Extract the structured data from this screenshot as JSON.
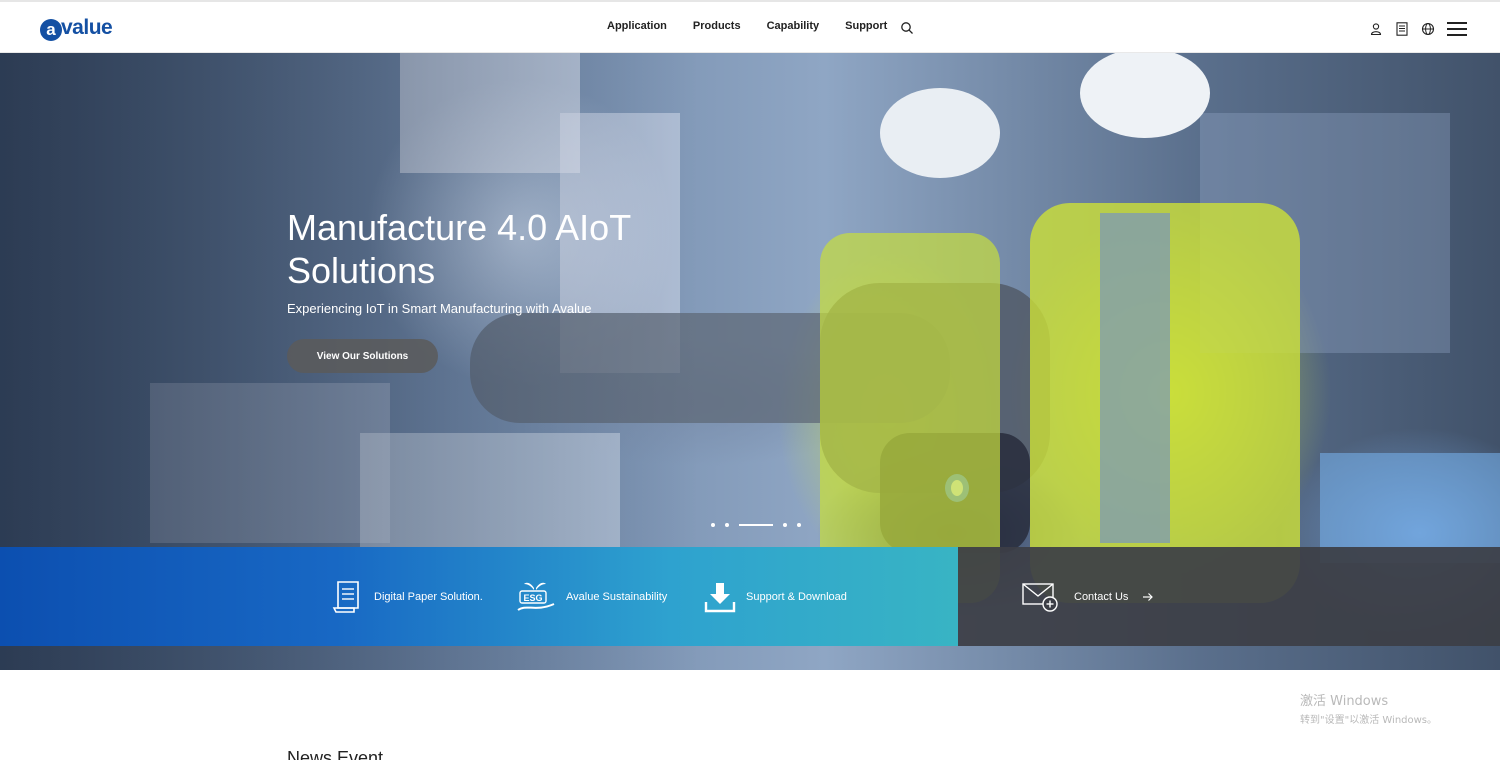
{
  "header": {
    "logo_letter": "a",
    "logo_text": "value",
    "nav": [
      "Application",
      "Products",
      "Capability",
      "Support"
    ],
    "icons": [
      "search-icon",
      "user-icon",
      "document-icon",
      "globe-icon",
      "menu-icon"
    ]
  },
  "hero": {
    "title": "Manufacture 4.0 AIoT Solutions",
    "subtitle": "Experiencing IoT in Smart Manufacturing with Avalue",
    "button_label": "View Our Solutions",
    "slide_count": 5,
    "active_slide": 3
  },
  "quick_links": [
    {
      "label": "Digital Paper Solution.",
      "icon": "digital-paper-icon"
    },
    {
      "label": "Avalue Sustainability",
      "icon": "esg-icon",
      "icon_text": "ESG"
    },
    {
      "label": "Support & Download",
      "icon": "download-icon"
    }
  ],
  "contact": {
    "label": "Contact Us",
    "icon": "mail-icon",
    "arrow": "→"
  },
  "section": {
    "title": "News Event"
  },
  "watermark": {
    "line1": "激活 Windows",
    "line2": "转到\"设置\"以激活 Windows。"
  },
  "colors": {
    "brand": "#1450a3",
    "quick_bar_start": "#0c4fb0",
    "quick_bar_end": "#38b4c4",
    "contact_bg": "#3c3e46"
  }
}
